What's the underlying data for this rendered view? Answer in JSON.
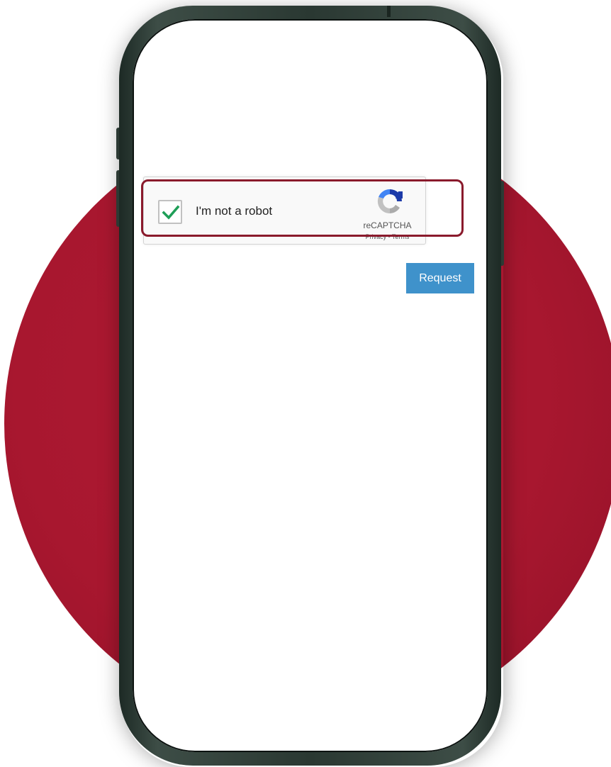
{
  "colors": {
    "backdrop": "#a8172f",
    "phone_frame": "#2f3d37",
    "highlight": "#8a1a2c",
    "request_button": "#3f92cb",
    "checkmark": "#1e9e57"
  },
  "recaptcha": {
    "checked": true,
    "label": "I'm not a robot",
    "brand": "reCAPTCHA",
    "links": "Privacy - Terms",
    "logo_icon": "recaptcha-logo-icon",
    "check_icon": "check-mark-icon"
  },
  "request_button": {
    "label": "Request"
  }
}
